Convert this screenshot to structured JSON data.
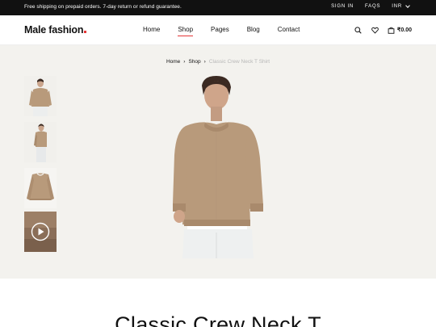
{
  "topbar": {
    "message": "Free shipping on prepaid orders. 7-day return or refund guarantee.",
    "sign_in": "SIGN IN",
    "faqs": "FAQS",
    "currency": "INR"
  },
  "header": {
    "logo": "Male fashion",
    "nav": [
      {
        "label": "Home",
        "active": false
      },
      {
        "label": "Shop",
        "active": true
      },
      {
        "label": "Pages",
        "active": false
      },
      {
        "label": "Blog",
        "active": false
      },
      {
        "label": "Contact",
        "active": false
      }
    ],
    "icons": [
      "search-icon",
      "heart-icon",
      "shopping-bag-icon"
    ],
    "cart_total": "₹0.00"
  },
  "breadcrumb": {
    "home": "Home",
    "shop": "Shop",
    "current": "Classic Crew Neck T Shirt"
  },
  "thumbnails": [
    {
      "name": "front-view"
    },
    {
      "name": "side-view"
    },
    {
      "name": "flat-lay"
    },
    {
      "name": "video",
      "icon": "play-icon"
    }
  ],
  "product": {
    "title": "Classic Crew Neck T"
  },
  "colors": {
    "accent": "#e53637",
    "topbar": "#111111",
    "product_bg": "#f3f2ee",
    "sweater": "#b89a7b"
  }
}
